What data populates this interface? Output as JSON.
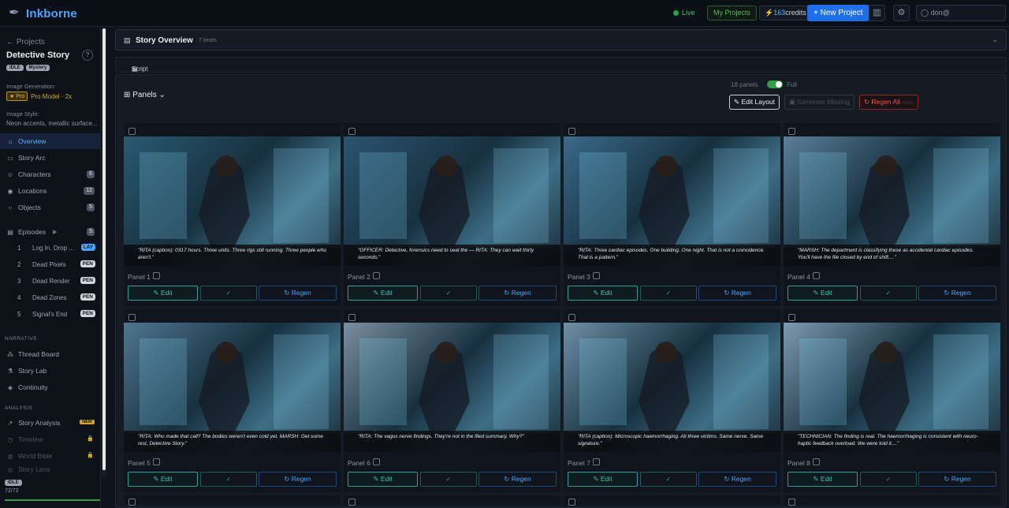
{
  "app": {
    "name": "Inkborne"
  },
  "topbar": {
    "live": "Live",
    "my_projects": "My Projects",
    "credits_value": "163",
    "credits_label": "credits",
    "new_project": "+ New Project",
    "user": "don@"
  },
  "sidebar": {
    "back": "← Projects",
    "project_title": "Detective Story",
    "help": "?",
    "badges": [
      "IDLE",
      "Mystery"
    ],
    "image_generation_label": "Image Generation:",
    "pro_tag": "★ Pro",
    "pro_model": "Pro Model · 2x",
    "image_style_label": "Image Style:",
    "image_style": "Neon accents, metallic surface...",
    "nav": [
      {
        "label": "Overview",
        "icon": "⌂"
      },
      {
        "label": "Story Arc",
        "icon": "▭"
      },
      {
        "label": "Characters",
        "icon": "☺",
        "count": "6"
      },
      {
        "label": "Locations",
        "icon": "◉",
        "count": "12"
      },
      {
        "label": "Objects",
        "icon": "○",
        "count": "5"
      }
    ],
    "episodes_label": "Episodes",
    "episodes_count": "5",
    "episodes": [
      {
        "n": "1",
        "title": "Log In. Drop ...",
        "status": "LAY"
      },
      {
        "n": "2",
        "title": "Dead Pixels",
        "status": "PEN"
      },
      {
        "n": "3",
        "title": "Dead Render",
        "status": "PEN"
      },
      {
        "n": "4",
        "title": "Dead Zones",
        "status": "PEN"
      },
      {
        "n": "5",
        "title": "Signal's End",
        "status": "PEN"
      }
    ],
    "narrative_label": "NARRATIVE",
    "narrative": [
      "Thread Board",
      "Story Lab",
      "Continuity"
    ],
    "analysis_label": "ANALYSIS",
    "story_analysis": "Story Analysis",
    "new_badge": "NEW",
    "locked": [
      "Timeline",
      "World Bible",
      "Story Lens"
    ],
    "bottom_badge": "IDLE",
    "bottom_progress": "72/72"
  },
  "overview": {
    "title": "Story Overview",
    "beats": "7 beats"
  },
  "script": {
    "label": "Script"
  },
  "panels": {
    "title": "Panels",
    "count": "18 panels",
    "full": "Full",
    "edit_layout": "Edit Layout",
    "generate_missing": "Generate Missing",
    "regen_all": "Regen All",
    "regen_all_hint": "HOLD",
    "edit": "Edit",
    "approve": "✓",
    "regen": "Regen",
    "items": [
      {
        "label": "Panel 1",
        "caption": "\"RITA (caption): 0317 hours. Three units. Three rigs still running. Three people who aren't.\"",
        "bg": "#2a5a72"
      },
      {
        "label": "Panel 2",
        "caption": "\"OFFICER: Detective, forensics need to seal the — RITA: They can wait thirty seconds.\"",
        "bg": "#2c5470"
      },
      {
        "label": "Panel 3",
        "caption": "\"RITA: Three cardiac episodes. One building. One night. That is not a coincidence. That is a pattern.\"",
        "bg": "#3a6a8a"
      },
      {
        "label": "Panel 4",
        "caption": "\"MARSH: The department is classifying these as accidental cardiac episodes. You'll have the file closed by end of shift....\"",
        "bg": "#5a7f9a"
      },
      {
        "label": "Panel 5",
        "caption": "\"RITA: Who made that call? The bodies weren't even cold yet. MARSH: Get some rest, Detective Story.\"",
        "bg": "#4f7690"
      },
      {
        "label": "Panel 6",
        "caption": "\"RITA: The vagus nerve findings. They're not in the filed summary. Why?\"",
        "bg": "#7a8fa0"
      },
      {
        "label": "Panel 7",
        "caption": "\"RITA (caption): Microscopic haemorrhaging. All three victims. Same nerve. Same signature.\"",
        "bg": "#6e8fa5"
      },
      {
        "label": "Panel 8",
        "caption": "\"TECHNICIAN: The finding is real. The haemorrhaging is consistent with neuro-haptic feedback overload. We were told it....\"",
        "bg": "#7e9ab0"
      }
    ]
  }
}
